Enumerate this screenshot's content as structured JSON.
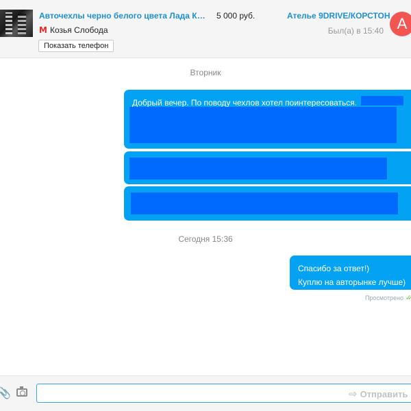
{
  "listing": {
    "title": "Авточехлы черно белого цвета Лада Кал…",
    "price": "5 000 руб.",
    "metro_icon": "metro-m-icon",
    "metro_glyph": "М",
    "metro_station": "Козья Слобода",
    "phone_button": "Показать телефон"
  },
  "seller": {
    "name": "Ателье 9DRIVE/КОРСТОН",
    "last_seen": "Был(а) в 15:40",
    "avatar_letter": "А",
    "avatar_color": "#f25653"
  },
  "chat": {
    "day_1": "Вторник",
    "message_1": "Добрый вечер. По поводу чехлов хотел поинтересоваться.",
    "day_2": "Сегодня 15:36",
    "message_2_line1": "Спасибо за ответ!)",
    "message_2_line2": "Куплю на авторынке лучше)",
    "read_status": "Просмотрено",
    "read_glyph": "✓✓"
  },
  "composer": {
    "attach_glyph": "📎",
    "placeholder": "",
    "send_glyph": "⇨",
    "send_label": "Отправить"
  },
  "colors": {
    "link": "#1e90d6",
    "bubble": "#04a2f2",
    "redaction": "#006aff",
    "read_check": "#77c94d"
  }
}
